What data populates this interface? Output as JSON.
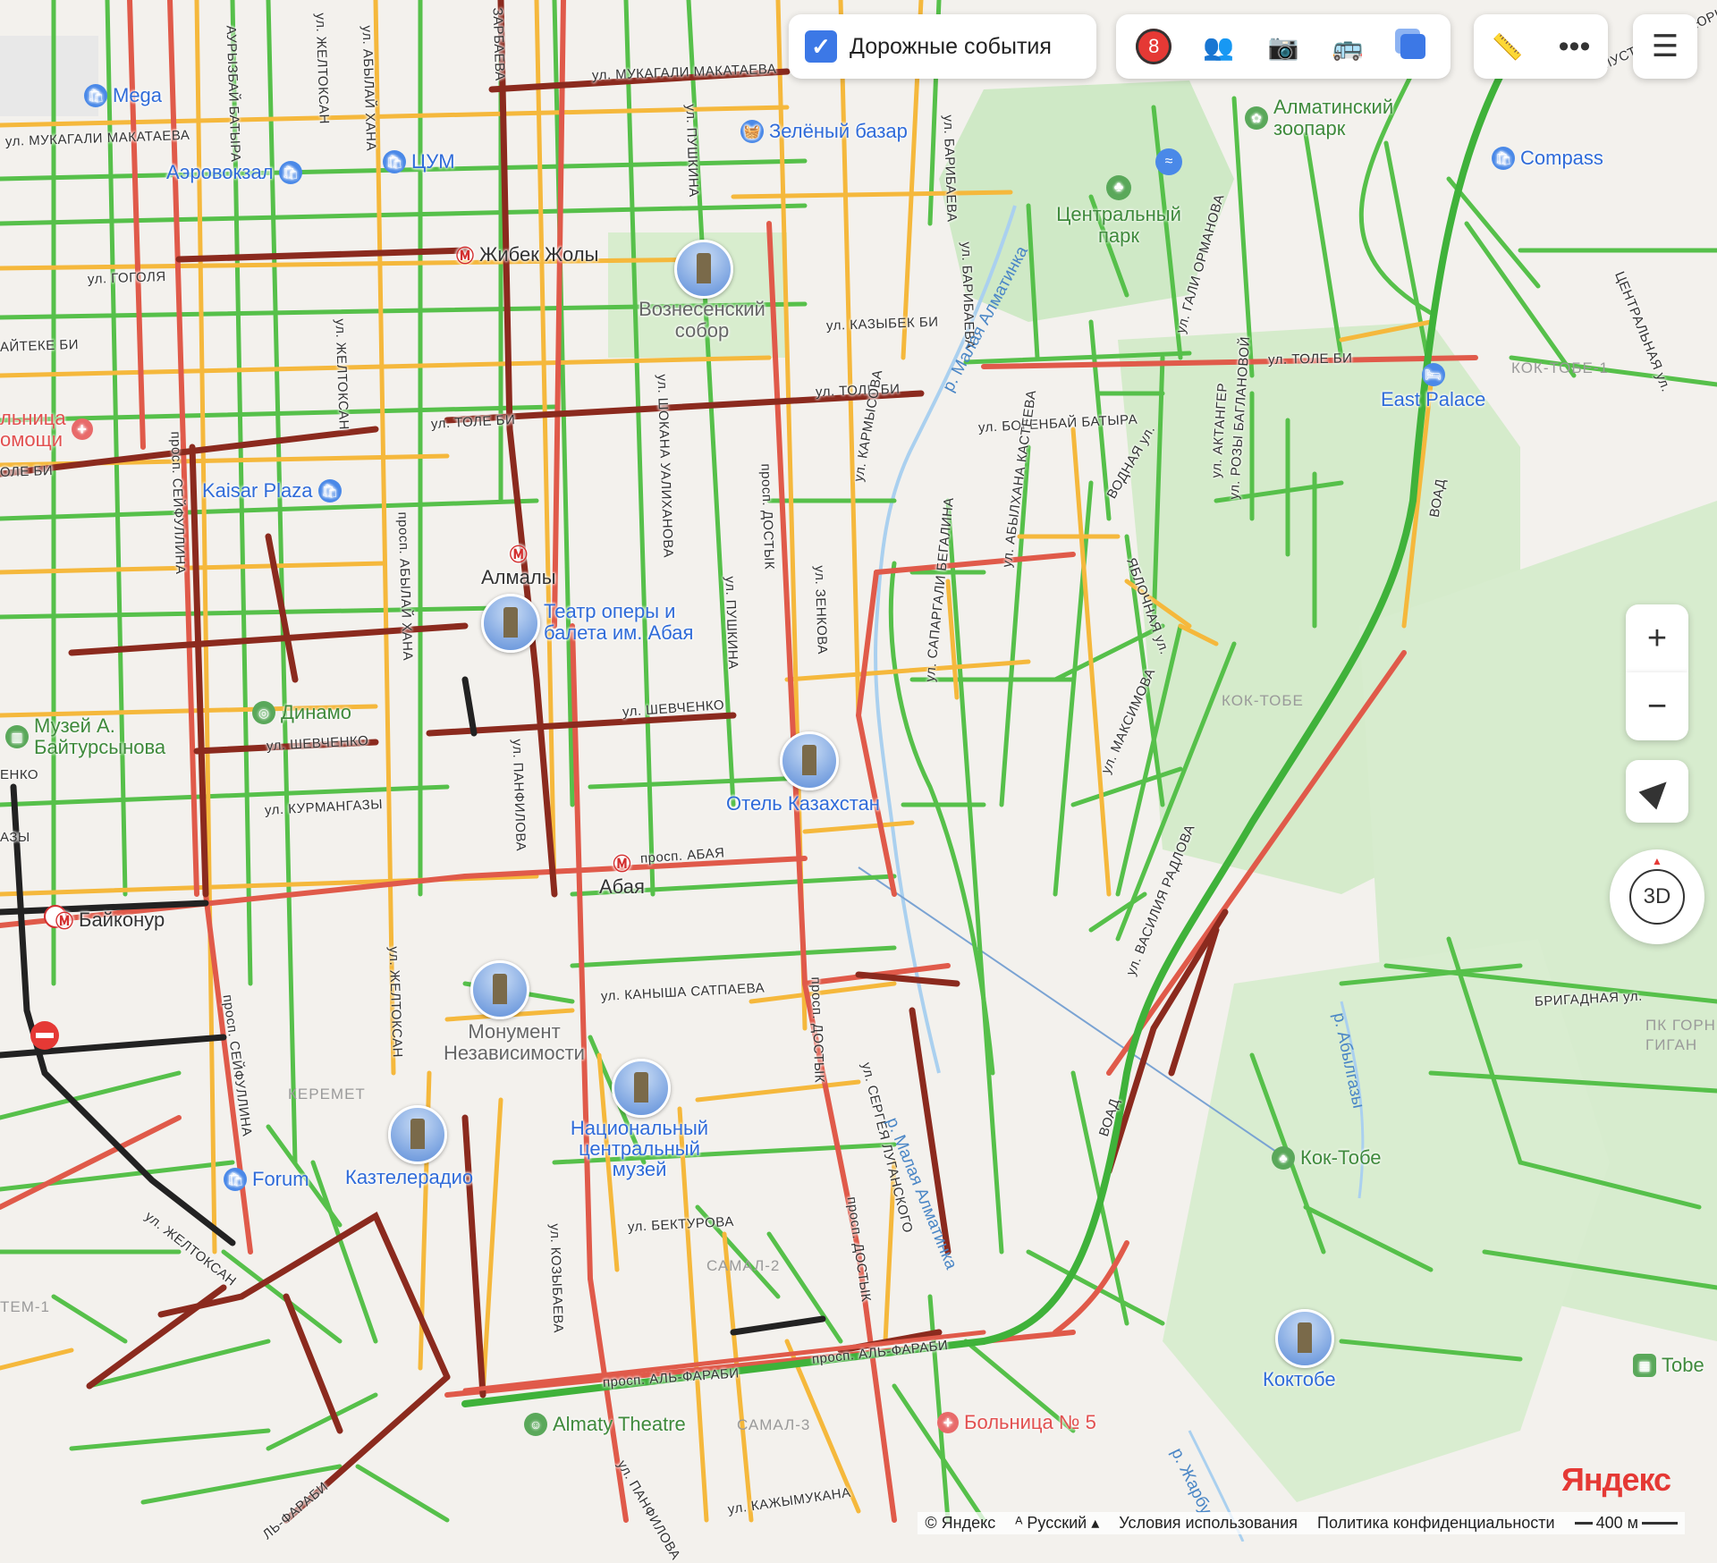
{
  "toolbar": {
    "traffic_events_label": "Дорожные события",
    "traffic_events_checked": true,
    "events_count": "8",
    "btn_3d_label": "3D",
    "zoom_in": "+",
    "zoom_out": "−"
  },
  "footer": {
    "copyright": "© Яндекс",
    "language": "Русский",
    "terms": "Условия использования",
    "privacy": "Политика конфиденциальности",
    "scale": "400 м",
    "logo": "Яндекс"
  },
  "colors": {
    "free": "#56c04a",
    "medium": "#f5b83c",
    "slow": "#e05a4a",
    "jam": "#8b2a1e",
    "closed": "#222222"
  },
  "pois": {
    "mega": "Mega",
    "green_bazaar": "Зелёный базар",
    "aerovokzal": "Аэровокзал",
    "tsum": "ЦУМ",
    "kaisar": "Kaisar Plaza",
    "dinamo": "Динамо",
    "museum_baitursynov_1": "Музей А.",
    "museum_baitursynov_2": "Байтурсынова",
    "forum": "Forum",
    "kaztelerad": "Казтелерадио",
    "hotel_kz": "Отель Казахстан",
    "east_palace": "East Palace",
    "compass": "Compass",
    "almaty_theatre": "Almaty Theatre",
    "tobe": "Tobe",
    "hospital_left_1": "льница",
    "hospital_left_2": "омощи",
    "hospital5": "Больница № 5"
  },
  "landmarks": {
    "cathedral_1": "Вознесенский",
    "cathedral_2": "собор",
    "opera_1": "Театр оперы и",
    "opera_2": "балета им. Абая",
    "monument_1": "Монумент",
    "monument_2": "Независимости",
    "museum_1": "Национальный",
    "museum_2": "центральный",
    "museum_3": "музей",
    "koktobe_tower": "Коктобе"
  },
  "parks": {
    "zoo_1": "Алматинский",
    "zoo_2": "зоопарк",
    "central_1": "Центральный",
    "central_2": "парк",
    "koktobe": "Кок-Тобе"
  },
  "metro": {
    "zhibek": "Жибек Жолы",
    "almaly": "Алмалы",
    "abaya": "Абая",
    "baikonur": "Байконур"
  },
  "districts": {
    "keremet": "КЕРЕМЕТ",
    "samal2": "САМАЛ-2",
    "samal3": "САМАЛ-3",
    "koktobe1": "КОК-ТОБЕ-1",
    "koktobe": "КОК-ТОБЕ",
    "tem1": "ТЕМ-1",
    "pk_gorny_1": "ПК ГОРН",
    "pk_gorny_2": "ГИГАН"
  },
  "streets": {
    "makataeva_top": "ул. МУКАГАЛИ МАКАТАЕВА",
    "makataeva_left": "ул. МУКАГАЛИ МАКАТАЕВА",
    "gogolya": "ул. ГОГОЛЯ",
    "aiteke": "АЙТЕКЕ БИ",
    "tole_bi_left": "ул. ТОЛЕ БИ",
    "tole_bi_mid": "ул. ТОЛЕ БИ",
    "tole_bi_right": "ул. ТОЛЕ БИ",
    "tole_bi_edge": "ОЛЕ БИ",
    "kazybek": "ул. КАЗЫБЕК БИ",
    "bogenbai": "ул. БОГЕНБАЙ БАТЫРА",
    "shevchenko_mid": "ул. ШЕВЧЕНКО",
    "shevchenko_left": "ул. ШЕВЧЕНКО",
    "shevchenko_edge": "ЕНКО",
    "kurmangazy": "ул. КУРМАНГАЗЫ",
    "kurmangazy_edge": "АЗЫ",
    "abaya": "просп. АБАЯ",
    "satpaeva": "ул. КАНЫША САТПАЕВА",
    "bektourova": "ул. БЕКТУРОВА",
    "al_farabi_1": "просп. АЛЬ-ФАРАБИ",
    "al_farabi_2": "просп. АЛЬ-ФАРАБИ",
    "al_farabi_3": "ЛЬ-ФАРАБИ",
    "kazhymukana": "ул. КАЖЫМУКАНА",
    "brigadnaya": "БРИГАДНАЯ ул.",
    "seifullina_1": "просп. СЕЙФУЛЛИНА",
    "seifullina_2": "просп. СЕЙФУЛЛИНА",
    "zheltoksan_1": "ул. ЖЕЛТОКСАН",
    "zheltoksan_2": "ул. ЖЕЛТОКСАН",
    "zheltoksan_3": "ул. ЖЕЛТОКСАН",
    "zheltoksan_4": "ул. ЖЕЛТОКСАН",
    "ablaikhan_1": "ул. АБЫЛАЙ ХАНА",
    "ablaikhan_2": "просп. АБЫЛАЙ ХАНА",
    "pushkina_1": "ул. ПУШКИНА",
    "pushkina_2": "ул. ПУШКИНА",
    "valikhanova": "ул. ШОКАНА УАЛИХАНОВА",
    "dostyk_1": "просп. ДОСТЫК",
    "dostyk_2": "просп. ДОСТЫК",
    "dostyk_3": "просп. ДОСТЫК",
    "zenkova": "ул. ЗЕНКОВА",
    "panfilova_1": "ул. ПАНФИЛОВА",
    "panfilova_2": "ул. ПАНФИЛОВА",
    "kozybaeva": "ул. КОЗЫБАЕВА",
    "lugansk": "ул. СЕРГЕЯ ЛУГАНСКОГО",
    "karmysova": "ул. КАРМЫСОВА",
    "begalina": "ул. САПАРГАЛИ БЕГАЛИНА",
    "kasteeva": "ул. АБЫЛХАНА КАСТЕЕВА",
    "vodnaya": "ВОДНАЯ ул.",
    "yablochnaya": "ЯБЛОЧНАЯ ул.",
    "maksimova": "ул. МАКСИМОВА",
    "radlova": "ул. ВАСИЛИЯ РАДЛОВА",
    "aktanger": "ул. АКТАНГЕР",
    "baglanovoi": "ул. РОЗЫ БАГЛАНОВОЙ",
    "ormanova": "ул. ГАЛИ ОРМАНОВА",
    "baribaeva_1": "ул. БАРИБАЕВА",
    "baribaeva_2": "ул. БАРИБАЕВА",
    "voad_1": "ВОАД",
    "voad_2": "ВОАД",
    "central_right": "ЦЕНТРАЛЬНАЯ ул.",
    "mustafy": "МУСТАФЫ ОЗТЮРКА",
    "zarbaeva": "ЗАРБАЕВА",
    "batyra": "АУРЫЗБАЙ БАТЫРА",
    "malaya_almatinka_1": "р. Малая Алматинка",
    "malaya_almatinka_2": "р. Малая Алматинка",
    "abylgazy": "р. Абылгазы",
    "zharbu": "р. Жарбу"
  }
}
